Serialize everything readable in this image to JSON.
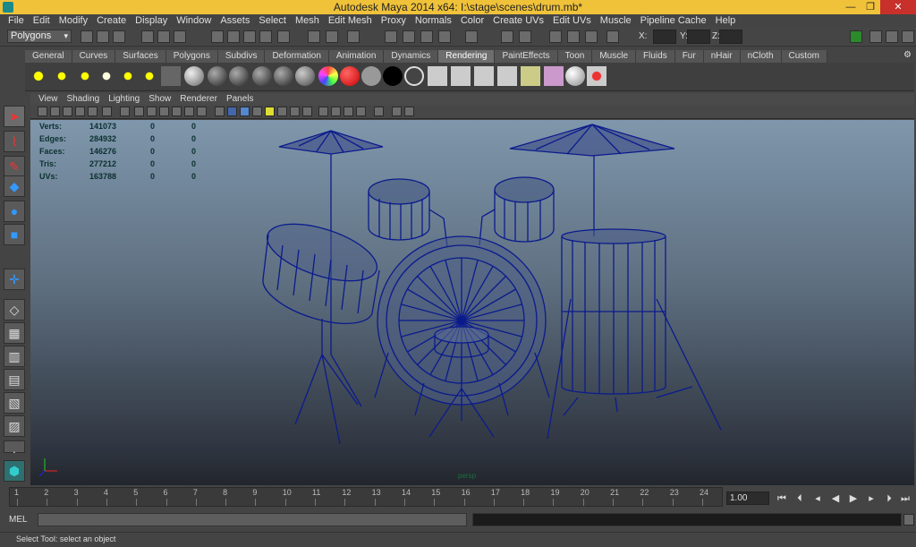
{
  "window": {
    "title": "Autodesk Maya 2014 x64: I:\\stage\\scenes\\drum.mb*"
  },
  "menubar": [
    "File",
    "Edit",
    "Modify",
    "Create",
    "Display",
    "Window",
    "Assets",
    "Select",
    "Mesh",
    "Edit Mesh",
    "Proxy",
    "Normals",
    "Color",
    "Create UVs",
    "Edit UVs",
    "Muscle",
    "Pipeline Cache",
    "Help"
  ],
  "statusline": {
    "mode": "Polygons",
    "x_label": "X:",
    "y_label": "Y:",
    "z_label": "Z:"
  },
  "shelf_tabs": [
    "General",
    "Curves",
    "Surfaces",
    "Polygons",
    "Subdivs",
    "Deformation",
    "Animation",
    "Dynamics",
    "Rendering",
    "PaintEffects",
    "Toon",
    "Muscle",
    "Fluids",
    "Fur",
    "nHair",
    "nCloth",
    "Custom"
  ],
  "active_shelf_tab": "Rendering",
  "viewport_menu": [
    "View",
    "Shading",
    "Lighting",
    "Show",
    "Renderer",
    "Panels"
  ],
  "hud": {
    "rows": [
      {
        "label": "Verts:",
        "total": "141073",
        "selected": "0",
        "components": "0"
      },
      {
        "label": "Edges:",
        "total": "284932",
        "selected": "0",
        "components": "0"
      },
      {
        "label": "Faces:",
        "total": "146276",
        "selected": "0",
        "components": "0"
      },
      {
        "label": "Tris:",
        "total": "277212",
        "selected": "0",
        "components": "0"
      },
      {
        "label": "UVs:",
        "total": "163788",
        "selected": "0",
        "components": "0"
      }
    ],
    "camera": "persp"
  },
  "timeline": {
    "ticks": [
      "1",
      "2",
      "3",
      "4",
      "5",
      "6",
      "7",
      "8",
      "9",
      "10",
      "11",
      "12",
      "13",
      "14",
      "15",
      "16",
      "17",
      "18",
      "19",
      "20",
      "21",
      "22",
      "23",
      "24"
    ],
    "current_frame": "1.00"
  },
  "command_line": {
    "language": "MEL"
  },
  "help_line": "Select Tool: select an object",
  "colors": {
    "title_bar": "#f0c23a",
    "wireframe": "#0a1a8a",
    "close_button": "#c8302c"
  }
}
